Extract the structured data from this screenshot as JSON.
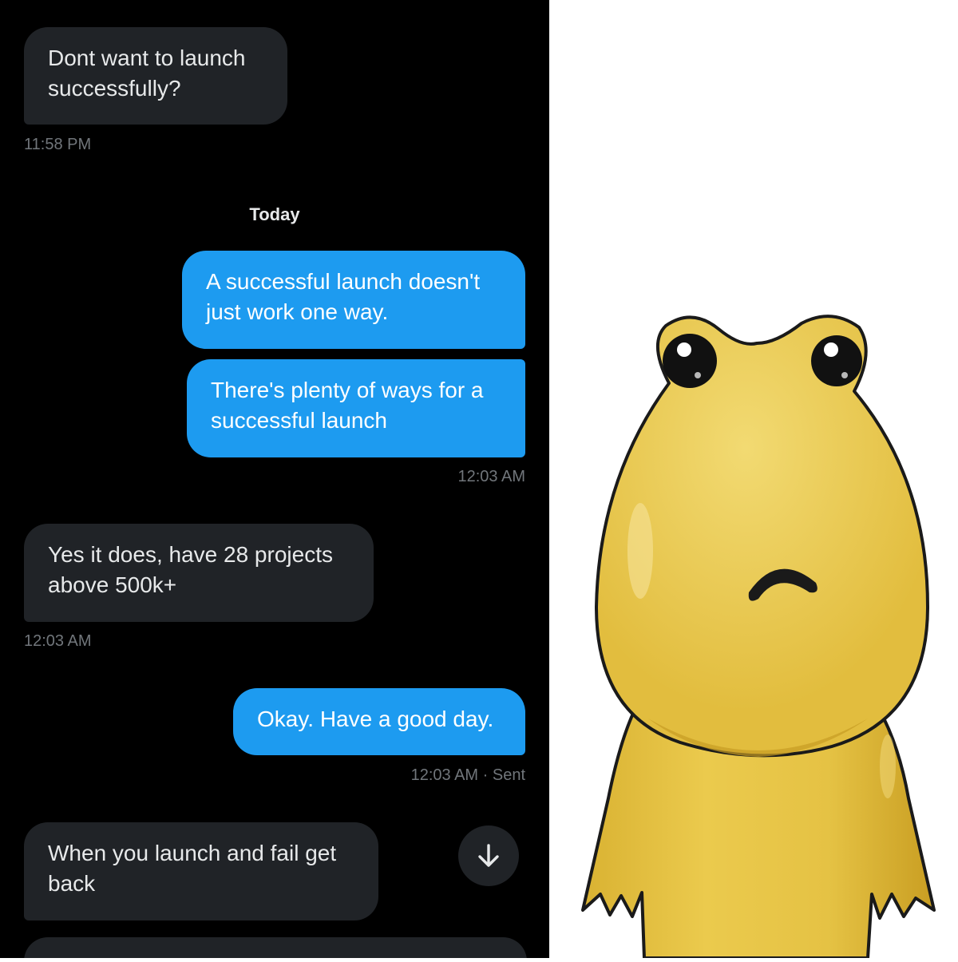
{
  "chat": {
    "messages": [
      {
        "side": "in",
        "text": "Dont want to launch successfully?"
      },
      {
        "side": "out",
        "text": "A successful launch doesn't just work one way."
      },
      {
        "side": "out",
        "text": "There's plenty of ways for a successful launch"
      },
      {
        "side": "in",
        "text": "Yes it does, have 28 projects above 500k+"
      },
      {
        "side": "out",
        "text": "Okay. Have a good day."
      },
      {
        "side": "in",
        "text": "When you launch and fail get back"
      }
    ],
    "timestamps": {
      "t1": "11:58 PM",
      "t2": "12:03 AM",
      "t3": "12:03 AM",
      "t4": "12:03 AM · Sent"
    },
    "day_separator": "Today",
    "scroll_button_icon": "arrow-down-icon"
  },
  "colors": {
    "background": "#000000",
    "incoming_bubble": "#202327",
    "outgoing_bubble": "#1d9bf0",
    "character_yellow": "#e8c64a"
  },
  "illustration": {
    "subject": "yellow-frog-character"
  }
}
